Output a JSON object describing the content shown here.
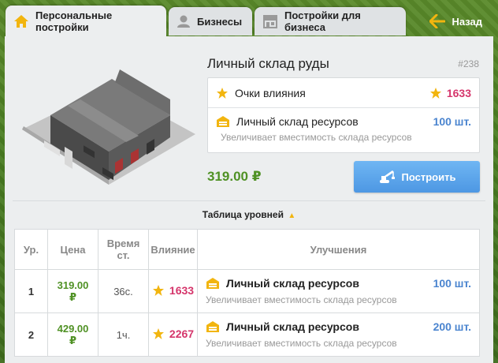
{
  "tabs": [
    {
      "label": "Персональные постройки",
      "icon": "house-icon",
      "active": true
    },
    {
      "label": "Бизнесы",
      "icon": "user-icon",
      "active": false
    },
    {
      "label": "Постройки для бизнеса",
      "icon": "store-icon",
      "active": false
    }
  ],
  "back_label": "Назад",
  "building": {
    "title": "Личный склад руды",
    "code": "#238",
    "image_icon": "warehouse-building-image",
    "influence_label": "Очки влияния",
    "influence_value": "1633",
    "resource_label": "Личный склад ресурсов",
    "resource_qty": "100 шт.",
    "resource_desc": "Увеличивает вместимость склада ресурсов",
    "price": "319.00 ₽",
    "build_label": "Построить"
  },
  "levels_title": "Таблица уровней",
  "table": {
    "headers": {
      "level": "Ур.",
      "price": "Цена",
      "time": "Время ст.",
      "influence": "Влияние",
      "improvements": "Улучшения"
    },
    "rows": [
      {
        "level": "1",
        "price_num": "319.00",
        "price_cur": "₽",
        "time": "36с.",
        "influence": "1633",
        "imp_label": "Личный склад ресурсов",
        "imp_qty": "100 шт.",
        "imp_desc": "Увеличивает вместимость склада ресурсов"
      },
      {
        "level": "2",
        "price_num": "429.00",
        "price_cur": "₽",
        "time": "1ч.",
        "influence": "2267",
        "imp_label": "Личный склад ресурсов",
        "imp_qty": "200 шт.",
        "imp_desc": "Увеличивает вместимость склада ресурсов"
      }
    ]
  },
  "colors": {
    "accent_yellow": "#f2b50f",
    "influence_pink": "#d5356b",
    "price_green": "#4f9124",
    "qty_blue": "#4a84cf",
    "button_blue": "#5aa3ea"
  }
}
